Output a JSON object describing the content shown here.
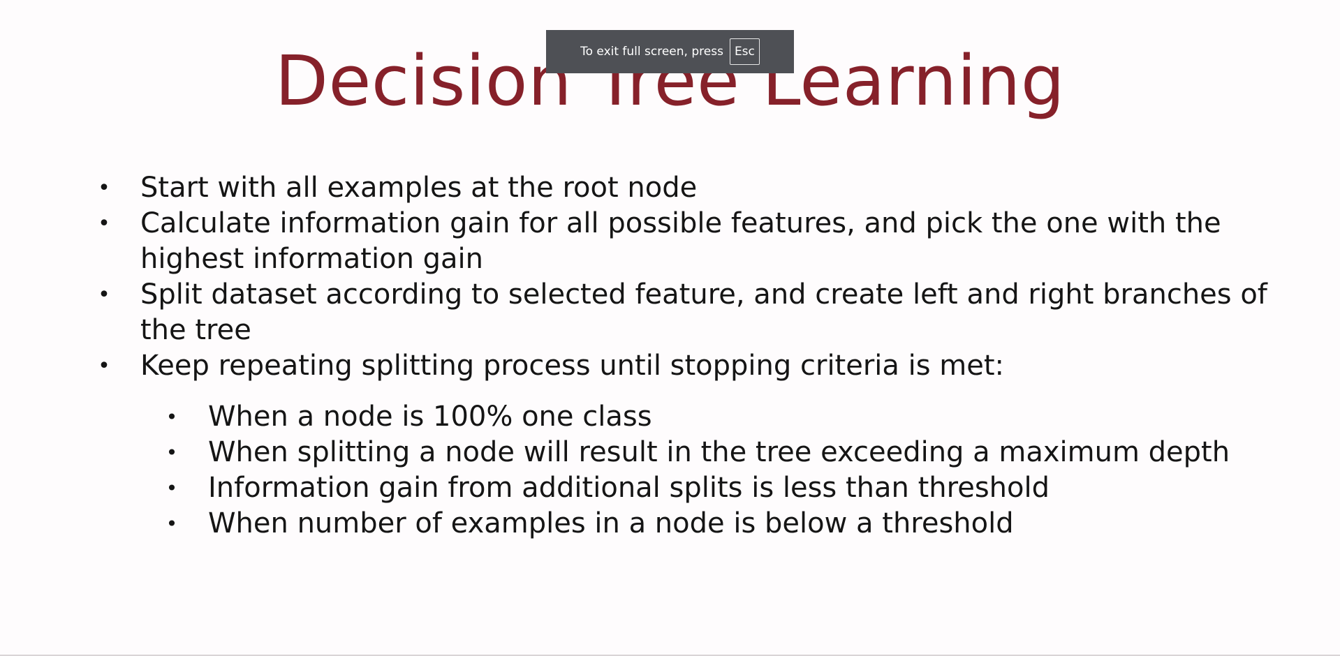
{
  "slide": {
    "title": "Decision Tree Learning",
    "bullets": [
      "Start with all examples at the root node",
      "Calculate information gain for all possible features, and pick the one with the highest information gain",
      "Split dataset according to selected feature, and create left and right branches of the tree",
      "Keep repeating splitting process until stopping criteria is met:"
    ],
    "sub_bullets": [
      "When a node is 100% one class",
      "When splitting a node will result in the tree exceeding a maximum depth",
      "Information gain from additional splits is less than threshold",
      "When number of examples in a node is below a threshold"
    ],
    "bullet_glyph": "•",
    "title_color": "#86212a"
  },
  "fullscreen_notice": {
    "text": "To exit full screen, press",
    "key": "Esc"
  }
}
